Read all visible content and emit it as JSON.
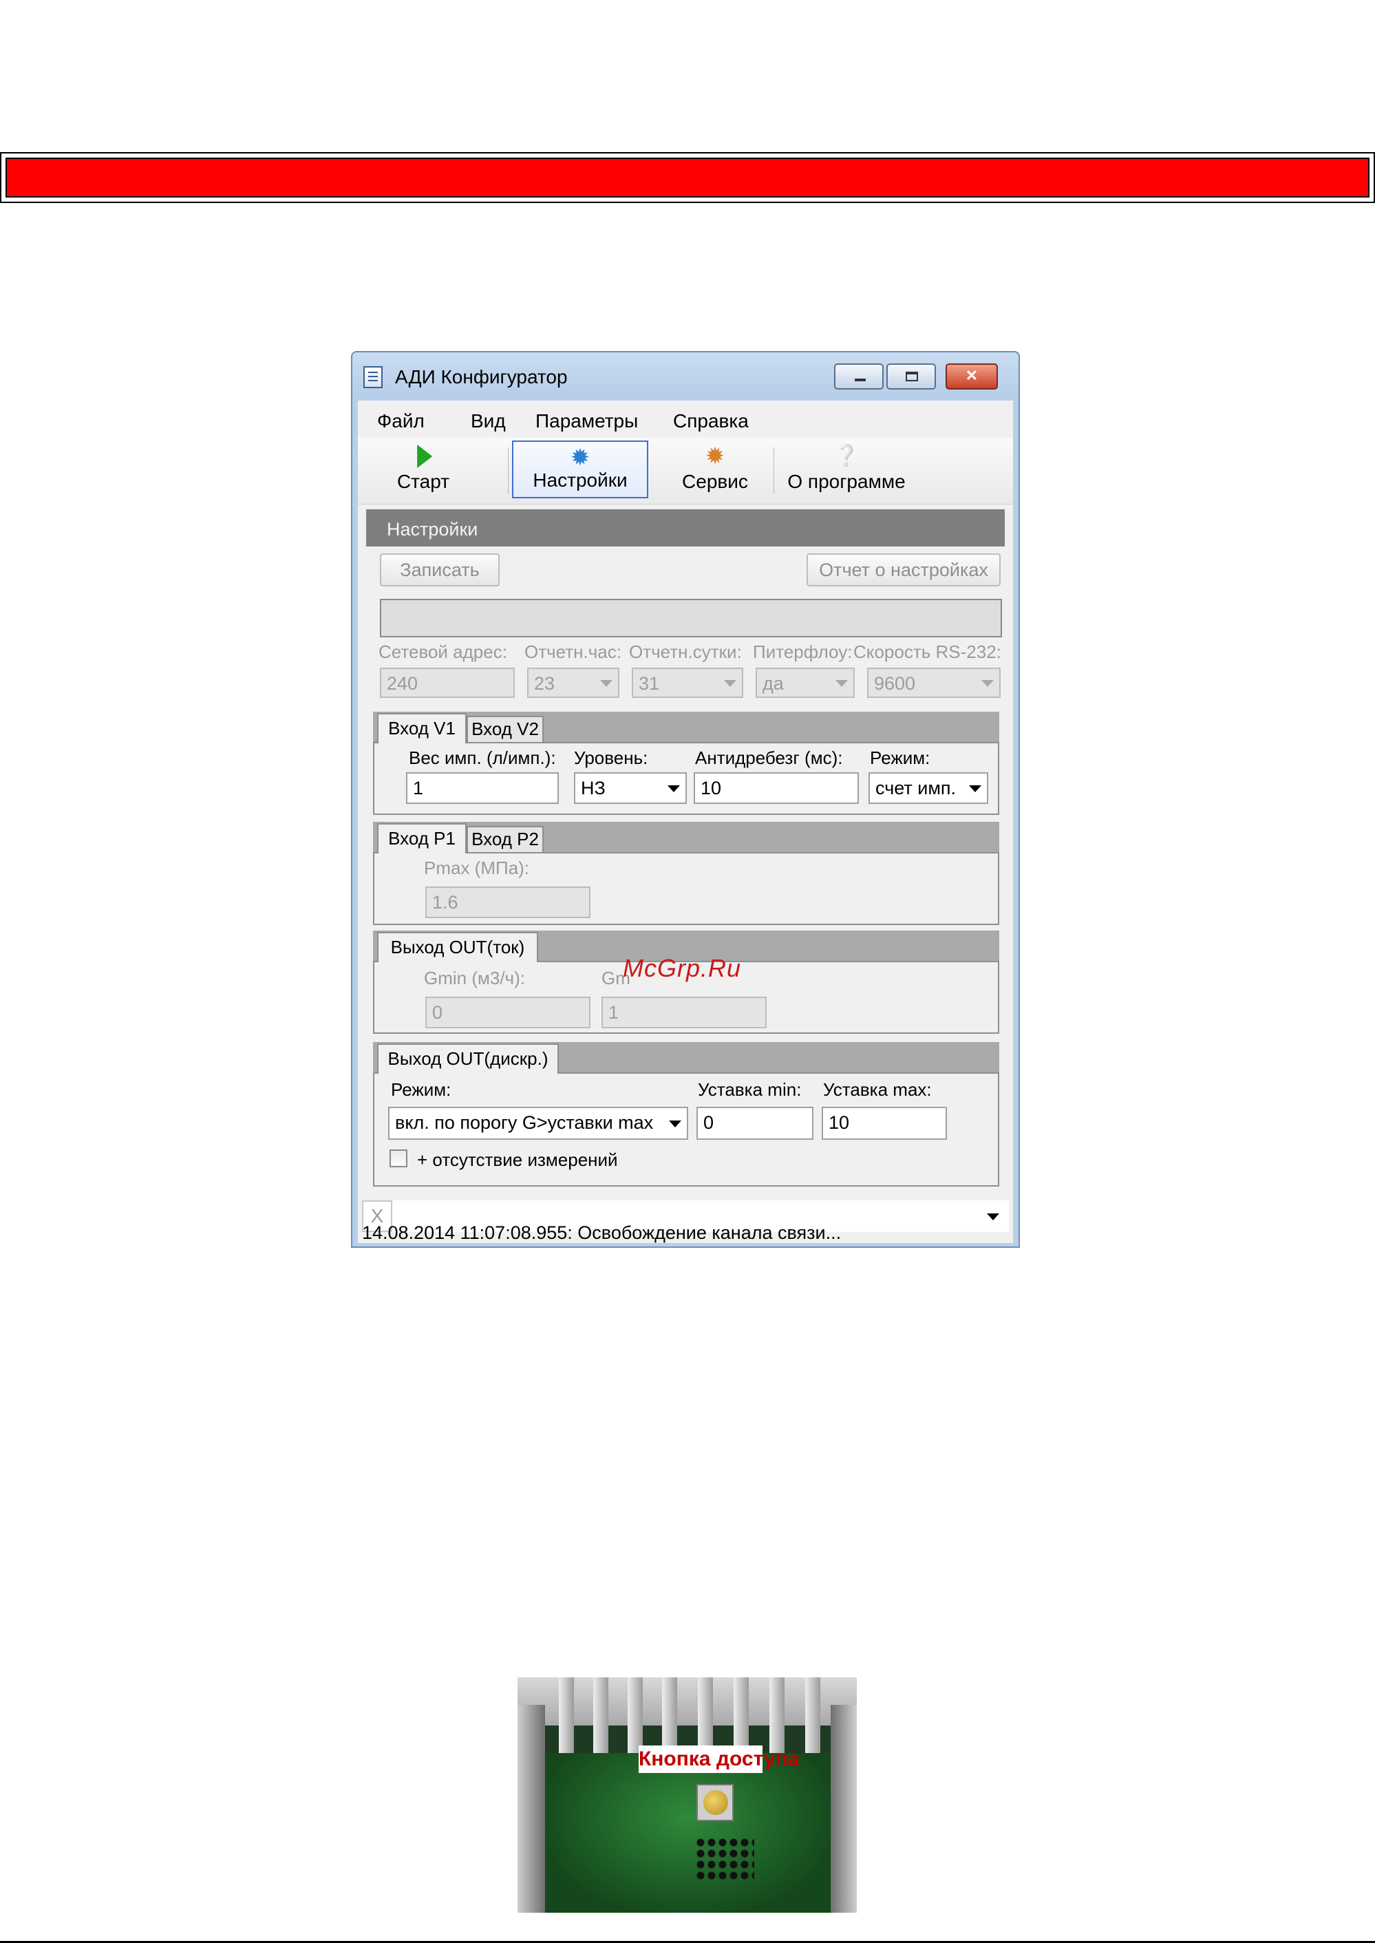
{
  "window": {
    "title": "АДИ Конфигуратор",
    "close_glyph": "✕"
  },
  "menu": [
    "Файл",
    "Вид",
    "Параметры",
    "Справка"
  ],
  "toolbar": {
    "start": "Старт",
    "settings": "Настройки",
    "service": "Сервис",
    "about": "О программе",
    "about_glyph": "❔",
    "gear_glyph": "✹"
  },
  "panel": {
    "title": "Настройки",
    "write_button": "Записать",
    "report_button": "Отчет о настройках"
  },
  "params": {
    "network_address_label": "Сетевой адрес:",
    "network_address_value": "240",
    "report_hour_label": "Отчетн.час:",
    "report_hour_value": "23",
    "report_day_label": "Отчетн.сутки:",
    "report_day_value": "31",
    "piterflow_label": "Питерфлоу:",
    "piterflow_value": "да",
    "rs232_label": "Скорость RS-232:",
    "rs232_value": "9600"
  },
  "input_v": {
    "tabs": [
      "Вход V1",
      "Вход V2"
    ],
    "weight_label": "Вес имп. (л/имп.):",
    "weight_value": "1",
    "level_label": "Уровень:",
    "level_value": "НЗ",
    "debounce_label": "Антидребезг (мс):",
    "debounce_value": "10",
    "mode_label": "Режим:",
    "mode_value": "счет имп."
  },
  "input_p": {
    "tabs": [
      "Вход P1",
      "Вход P2"
    ],
    "pmax_label": "Pmax (МПа):",
    "pmax_value": "1.6"
  },
  "output_current": {
    "tab": "Выход OUT(ток)",
    "gmin_label": "Gmin (м3/ч):",
    "gmin_value": "0",
    "gmax_label": "Gm",
    "gmax_value": "1"
  },
  "output_discrete": {
    "tab": "Выход OUT(дискр.)",
    "mode_label": "Режим:",
    "mode_value": "вкл. по порогу G>уставки max",
    "setpoint_min_label": "Уставка min:",
    "setpoint_min_value": "0",
    "setpoint_max_label": "Уставка max:",
    "setpoint_max_value": "10",
    "no_measure_label": "+ отсутствие измерений"
  },
  "log": {
    "clear_label": "X",
    "status": "14.08.2014 11:07:08.955: Освобождение канала связи..."
  },
  "watermark": "McGrp.Ru",
  "photo": {
    "label": "Кнопка доступа"
  }
}
